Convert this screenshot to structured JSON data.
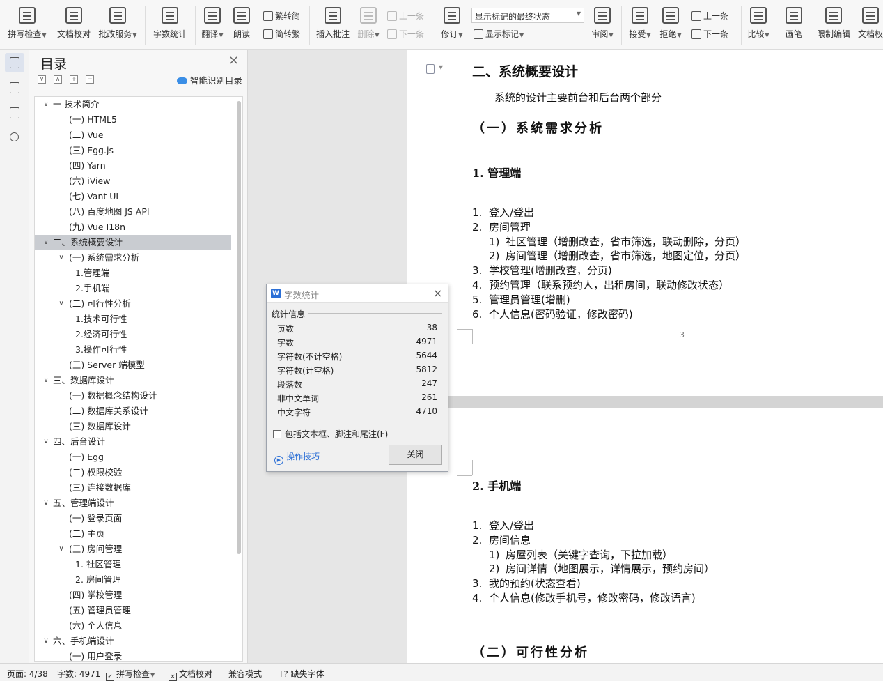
{
  "ribbon": {
    "spell_check": "拼写检查",
    "doc_proofread": "文档校对",
    "batch_service": "批改服务",
    "word_count": "字数统计",
    "translate": "翻译",
    "read_aloud": "朗读",
    "trad_to_simp": "繁转简",
    "simp_to_trad": "简转繁",
    "insert_comment": "插入批注",
    "delete": "删除",
    "prev_comment": "上一条",
    "next_comment": "下一条",
    "revise": "修订",
    "markup_state": "显示标记的最终状态",
    "show_markup": "显示标记",
    "review": "审阅",
    "accept": "接受",
    "reject": "拒绝",
    "prev_change": "上一条",
    "next_change": "下一条",
    "compare": "比较",
    "pen": "画笔",
    "restrict_edit": "限制编辑",
    "doc_rights": "文档权"
  },
  "toc": {
    "title": "目录",
    "smart_label": "智能识别目录",
    "items": [
      {
        "label": "一 技术简介",
        "level": 1,
        "toggle": "∨"
      },
      {
        "label": "(一)    HTML5",
        "level": 2
      },
      {
        "label": "(二) Vue",
        "level": 2
      },
      {
        "label": "(三) Egg.js",
        "level": 2
      },
      {
        "label": "(四) Yarn",
        "level": 2
      },
      {
        "label": "(六) iView",
        "level": 2
      },
      {
        "label": "(七) Vant UI",
        "level": 2
      },
      {
        "label": "(八) 百度地图 JS API",
        "level": 2
      },
      {
        "label": "(九) Vue I18n",
        "level": 2
      },
      {
        "label": "二、系统概要设计",
        "level": 1,
        "toggle": "∨",
        "selected": true
      },
      {
        "label": "(一) 系统需求分析",
        "level": 2,
        "toggle": "∨"
      },
      {
        "label": "1.管理端",
        "level": 3
      },
      {
        "label": "2.手机端",
        "level": 3
      },
      {
        "label": "(二) 可行性分析",
        "level": 2,
        "toggle": "∨"
      },
      {
        "label": "1.技术可行性",
        "level": 3
      },
      {
        "label": "2.经济可行性",
        "level": 3
      },
      {
        "label": "3.操作可行性",
        "level": 3
      },
      {
        "label": "(三) Server 端模型",
        "level": 2
      },
      {
        "label": "三、数据库设计",
        "level": 1,
        "toggle": "∨"
      },
      {
        "label": "(一) 数据概念结构设计",
        "level": 2
      },
      {
        "label": "(二) 数据库关系设计",
        "level": 2
      },
      {
        "label": "(三) 数据库设计",
        "level": 2
      },
      {
        "label": "四、后台设计",
        "level": 1,
        "toggle": "∨"
      },
      {
        "label": "(一)   Egg",
        "level": 2
      },
      {
        "label": "(二)   权限校验",
        "level": 2
      },
      {
        "label": "(三) 连接数据库",
        "level": 2
      },
      {
        "label": "五、管理端设计",
        "level": 1,
        "toggle": "∨"
      },
      {
        "label": "(一) 登录页面",
        "level": 2
      },
      {
        "label": "(二) 主页",
        "level": 2
      },
      {
        "label": "(三) 房间管理",
        "level": 2,
        "toggle": "∨"
      },
      {
        "label": "1. 社区管理",
        "level": 3
      },
      {
        "label": "2. 房间管理",
        "level": 3
      },
      {
        "label": "(四) 学校管理",
        "level": 2
      },
      {
        "label": "(五) 管理员管理",
        "level": 2
      },
      {
        "label": "(六) 个人信息",
        "level": 2
      },
      {
        "label": "六、手机端设计",
        "level": 1,
        "toggle": "∨"
      },
      {
        "label": "(一) 用户登录",
        "level": 2
      }
    ]
  },
  "doc": {
    "page1": {
      "h2": "二、系统概要设计",
      "intro": "系统的设计主要前台和后台两个部分",
      "h3": "（一）系统需求分析",
      "h4": "1.  管理端",
      "list": [
        {
          "n": "1.",
          "text": "登入/登出",
          "sub": false
        },
        {
          "n": "2.",
          "text": "房间管理",
          "sub": false
        },
        {
          "n": "1)",
          "text": "社区管理（增删改查，省市筛选，联动删除，分页）",
          "sub": true
        },
        {
          "n": "2)",
          "text": "房间管理（增删改查，省市筛选，地图定位，分页）",
          "sub": true
        },
        {
          "n": "3.",
          "text": "学校管理(增删改查，分页)",
          "sub": false
        },
        {
          "n": "4.",
          "text": "预约管理（联系预约人，出租房间，联动修改状态）",
          "sub": false
        },
        {
          "n": "5.",
          "text": "管理员管理(增删)",
          "sub": false
        },
        {
          "n": "6.",
          "text": "个人信息(密码验证，修改密码)",
          "sub": false
        }
      ],
      "page_number": "3"
    },
    "page2": {
      "h4": "2.  手机端",
      "list": [
        {
          "n": "1.",
          "text": "登入/登出",
          "sub": false
        },
        {
          "n": "2.",
          "text": "房间信息",
          "sub": false
        },
        {
          "n": "1)",
          "text": "房屋列表（关键字查询，下拉加载）",
          "sub": true
        },
        {
          "n": "2)",
          "text": "房间详情（地图展示，详情展示，预约房间）",
          "sub": true
        },
        {
          "n": "3.",
          "text": "我的预约(状态查看)",
          "sub": false
        },
        {
          "n": "4.",
          "text": "个人信息(修改手机号，修改密码，修改语言)",
          "sub": false
        }
      ],
      "h3": "（二）可行性分析"
    }
  },
  "dialog": {
    "title": "字数统计",
    "group_label": "统计信息",
    "stats": [
      {
        "label": "页数",
        "value": "38"
      },
      {
        "label": "字数",
        "value": "4971"
      },
      {
        "label": "字符数(不计空格)",
        "value": "5644"
      },
      {
        "label": "字符数(计空格)",
        "value": "5812"
      },
      {
        "label": "段落数",
        "value": "247"
      },
      {
        "label": "非中文单词",
        "value": "261"
      },
      {
        "label": "中文字符",
        "value": "4710"
      }
    ],
    "checkbox_label": "包括文本框、脚注和尾注(F)",
    "checkbox_checked": false,
    "tips_label": "操作技巧",
    "close_label": "关闭"
  },
  "status": {
    "page": "页面: 4/38",
    "words": "字数: 4971",
    "spell_check": "拼写检查",
    "doc_proofread": "文档校对",
    "compat_mode": "兼容模式",
    "missing_font": "缺失字体"
  }
}
